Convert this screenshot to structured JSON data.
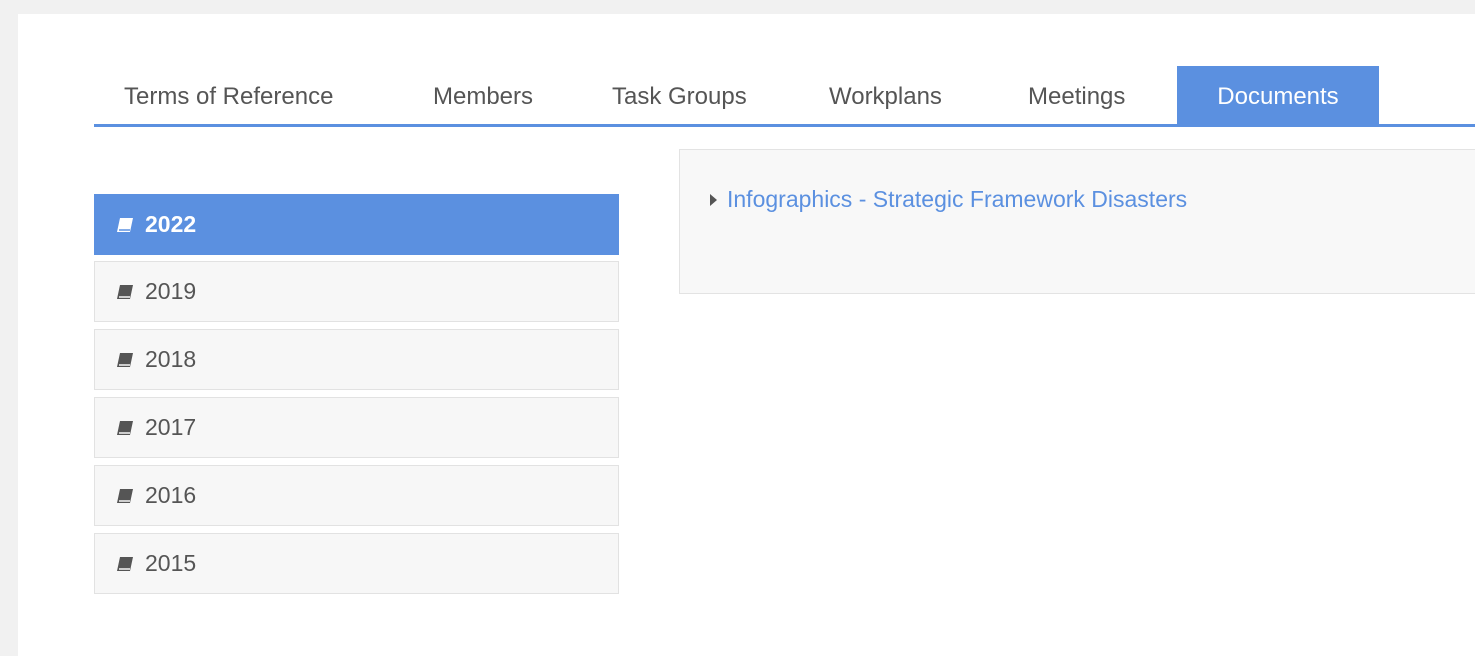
{
  "tabs": [
    {
      "label": "Terms of Reference"
    },
    {
      "label": "Members"
    },
    {
      "label": "Task Groups"
    },
    {
      "label": "Workplans"
    },
    {
      "label": "Meetings"
    },
    {
      "label": "Documents",
      "active": true
    }
  ],
  "years": [
    {
      "label": "2022",
      "active": true
    },
    {
      "label": "2019"
    },
    {
      "label": "2018"
    },
    {
      "label": "2017"
    },
    {
      "label": "2016"
    },
    {
      "label": "2015"
    }
  ],
  "documents": {
    "items": [
      {
        "title": "Infographics - Strategic Framework Disasters",
        "icon": "caret-right-icon"
      }
    ]
  },
  "colors": {
    "accent": "#5b90e0",
    "text": "#555555",
    "panel_bg": "#f8f8f8",
    "item_bg": "#f7f7f7",
    "border": "#e2e2e2"
  },
  "icons": {
    "year_item": "book-icon",
    "document_item": "caret-right-icon"
  }
}
